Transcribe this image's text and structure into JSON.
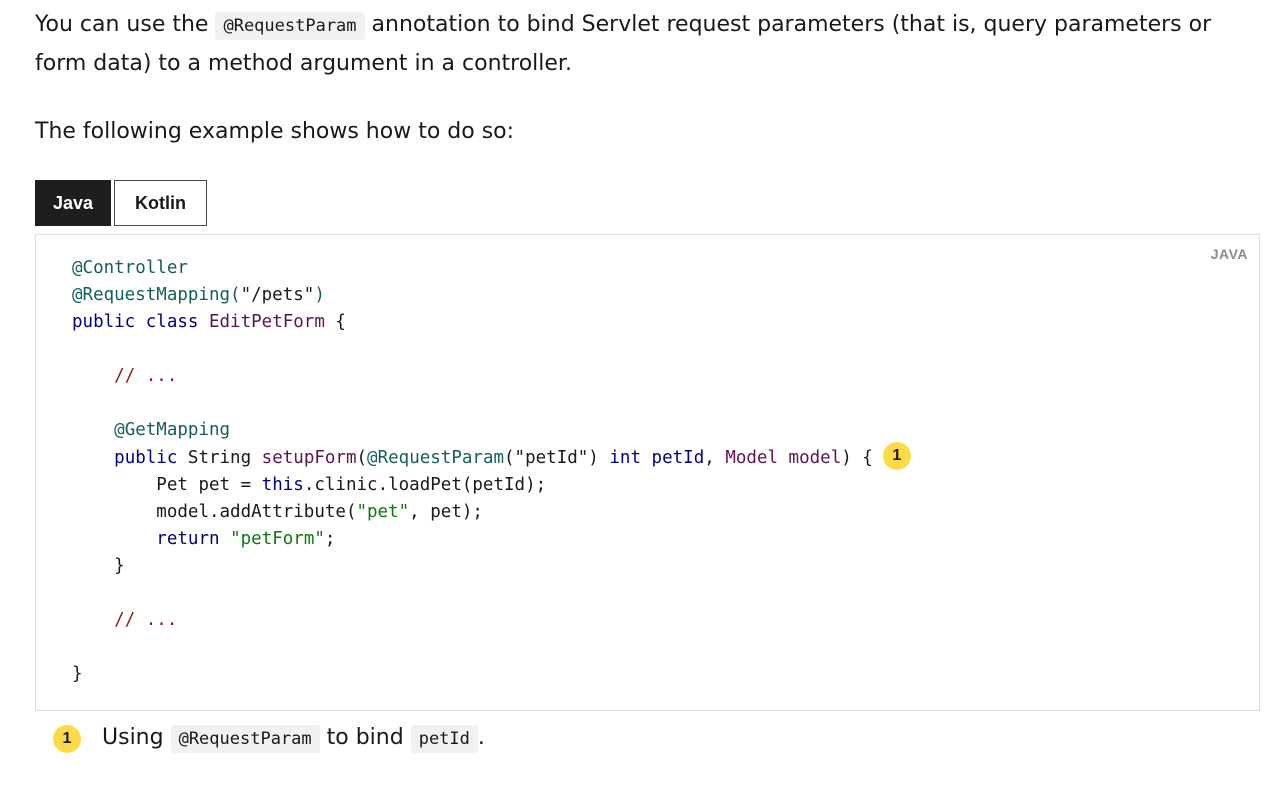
{
  "intro": {
    "text_before": "You can use the ",
    "code": "@RequestParam",
    "text_after": " annotation to bind Servlet request parameters (that is, query parameters or form data) to a method argument in a controller."
  },
  "example_intro": "The following example shows how to do so:",
  "tabs": [
    {
      "label": "Java",
      "active": true
    },
    {
      "label": "Kotlin",
      "active": false
    }
  ],
  "code_block": {
    "language_label": "JAVA",
    "tokens": {
      "l1_ann": "@Controller",
      "l2_ann": "@RequestMapping(",
      "l2_str": "\"/pets\"",
      "l2_end": ")",
      "l3_kw": "public class",
      "l3_cls": "EditPetForm",
      "l3_end": " {",
      "cmt": "// ...",
      "l7_ann": "@GetMapping",
      "l8_kw1": "public",
      "l8_type": " String ",
      "l8_method": "setupForm",
      "l8_open": "(",
      "l8_ann": "@RequestParam",
      "l8_str": "(\"petId\")",
      "l8_kw2": "int",
      "l8_param1": "petId",
      "l8_comma": ", ",
      "l8_cls": "Model",
      "l8_param2": "model",
      "l8_end": ") {",
      "l9_pre": "Pet pet = ",
      "l9_kw": "this",
      "l9_rest": ".clinic.loadPet(petId);",
      "l10_pre": "model.addAttribute(",
      "l10_str": "\"pet\"",
      "l10_rest": ", pet);",
      "l11_kw": "return",
      "l11_str": "\"petForm\"",
      "l11_end": ";",
      "close_brace": "}"
    },
    "callout_marker": "1"
  },
  "callout_list": [
    {
      "number": "1",
      "text_before": "Using ",
      "code1": "@RequestParam",
      "text_mid": " to bind ",
      "code2": "petId",
      "text_after": "."
    }
  ],
  "colors": {
    "tab_active_bg": "#1e1e1e",
    "callout_bg": "#fddb47",
    "inline_code_bg": "#f1f1f1",
    "annotation": "#155e5e",
    "keyword": "#000080",
    "class_name": "#5a1454",
    "string": "#0b7a0b",
    "comment": "#8b1a1a"
  }
}
